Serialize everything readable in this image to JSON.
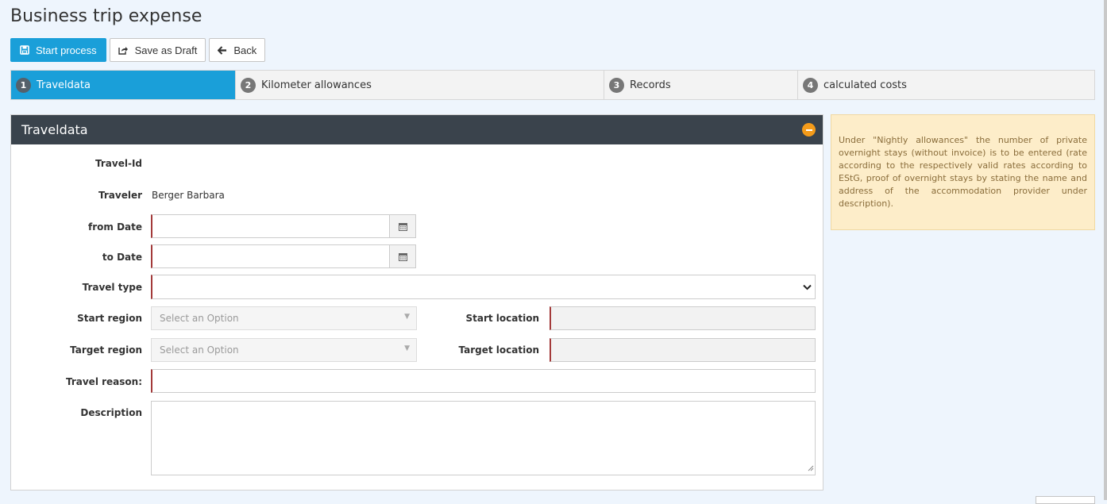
{
  "page": {
    "title": "Business trip expense"
  },
  "toolbar": {
    "start_label": "Start process",
    "draft_label": "Save as Draft",
    "back_label": "Back"
  },
  "steps": [
    {
      "num": "1",
      "label": "Traveldata",
      "active": true
    },
    {
      "num": "2",
      "label": "Kilometer allowances",
      "active": false
    },
    {
      "num": "3",
      "label": "Records",
      "active": false
    },
    {
      "num": "4",
      "label": "calculated costs",
      "active": false
    }
  ],
  "panel": {
    "title": "Traveldata"
  },
  "form": {
    "travel_id_label": "Travel-Id",
    "travel_id_value": "",
    "traveler_label": "Traveler",
    "traveler_value": "Berger Barbara",
    "from_date_label": "from Date",
    "from_date_value": "",
    "to_date_label": "to Date",
    "to_date_value": "",
    "travel_type_label": "Travel type",
    "travel_type_value": "",
    "start_region_label": "Start region",
    "start_region_placeholder": "Select an Option",
    "start_location_label": "Start location",
    "target_region_label": "Target region",
    "target_region_placeholder": "Select an Option",
    "target_location_label": "Target location",
    "travel_reason_label": "Travel reason:",
    "description_label": "Description"
  },
  "info": {
    "text": "Under \"Nightly allowances\" the number of private overnight stays (without invoice) is to be entered (rate according to the respectively valid rates according to EStG, proof of overnight stays by stating the name and address of the accommodation provider under description)."
  },
  "colors": {
    "primary": "#1a9fd9",
    "header": "#3a434c",
    "accent_orange": "#f49b1a",
    "info_bg": "#fdedc9",
    "required_border": "#a33a3a"
  }
}
